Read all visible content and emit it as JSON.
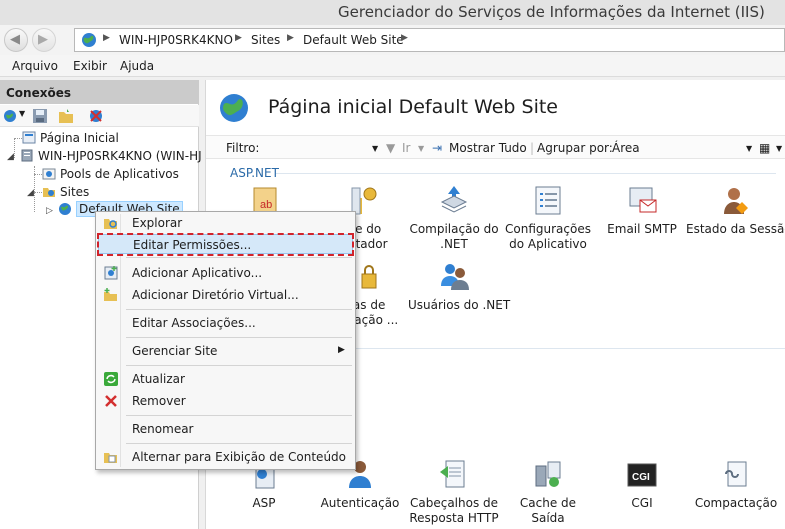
{
  "window": {
    "title": "Gerenciador do Serviços de Informações da Internet (IIS)"
  },
  "address": {
    "crumbs": [
      "WIN-HJP0SRK4KNO",
      "Sites",
      "Default Web Site"
    ]
  },
  "menu": [
    "Arquivo",
    "Exibir",
    "Ajuda"
  ],
  "connections": {
    "header": "Conexões",
    "tree": {
      "start_page": "Página Inicial",
      "server": "WIN-HJP0SRK4KNO (WIN-HJ",
      "app_pools": "Pools de Aplicativos",
      "sites": "Sites",
      "default_site": "Default Web Site"
    }
  },
  "main": {
    "title": "Página inicial Default Web Site",
    "filter": {
      "label": "Filtro:",
      "go": "Ir",
      "show_all": "Mostrar Tudo",
      "group_label": "Agrupar por:",
      "group_value": "Área"
    },
    "section_aspnet": "ASP.NET",
    "features_row1": [
      {
        "label": "",
        "icon": "aspnet-ab-icon"
      },
      {
        "label": "ve do\nutador",
        "icon": "key-icon"
      },
      {
        "label": "Compilação do\n.NET",
        "icon": "compile-icon"
      },
      {
        "label": "Configurações\ndo Aplicativo",
        "icon": "app-settings-icon"
      },
      {
        "label": "Email SMTP",
        "icon": "email-icon"
      },
      {
        "label": "Estado da Sessão",
        "icon": "session-icon"
      }
    ],
    "features_row2": [
      {
        "label": "ras de\nzação ...",
        "icon": "lock-icon"
      },
      {
        "label": "Usuários do .NET",
        "icon": "users-icon"
      }
    ],
    "features_row3": [
      {
        "label": "ASP",
        "icon": "asp-icon"
      },
      {
        "label": "Autenticação",
        "icon": "auth-icon"
      },
      {
        "label": "Cabeçalhos de\nResposta HTTP",
        "icon": "headers-icon"
      },
      {
        "label": "Cache de Saída",
        "icon": "cache-icon"
      },
      {
        "label": "CGI",
        "icon": "cgi-icon"
      },
      {
        "label": "Compactação",
        "icon": "compress-icon"
      }
    ]
  },
  "context_menu": {
    "explore": "Explorar",
    "edit_permissions": "Editar Permissões...",
    "add_app": "Adicionar Aplicativo...",
    "add_vdir": "Adicionar Diretório Virtual...",
    "edit_bindings": "Editar Associações...",
    "manage_site": "Gerenciar Site",
    "refresh": "Atualizar",
    "remove": "Remover",
    "rename": "Renomear",
    "switch_view": "Alternar para Exibição de Conteúdo"
  }
}
